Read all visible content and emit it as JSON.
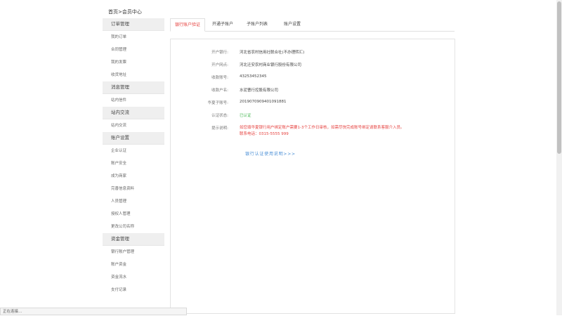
{
  "breadcrumb": "首页>会员中心",
  "sidebar": {
    "groups": [
      {
        "title": "订单管理",
        "items": [
          "我的订单",
          "合同管理",
          "我的发票",
          "收货地址"
        ]
      },
      {
        "title": "消息管理",
        "items": [
          "站内信件"
        ]
      },
      {
        "title": "站内交流",
        "items": [
          "站内交流"
        ]
      },
      {
        "title": "账户设置",
        "items": [
          "企业认证",
          "账户安全",
          "成为商家",
          "完善信息资料",
          "人员管理",
          "授权人管理",
          "更改公司名称"
        ]
      },
      {
        "title": "资金管理",
        "items": [
          "银行账户管理",
          "账户资金",
          "资金流水",
          "支付记录"
        ]
      }
    ]
  },
  "tabs": [
    "银行账户验证",
    "开通子账户",
    "子账户列表",
    "账户设置"
  ],
  "form": {
    "bank_label": "开户银行:",
    "bank_value": "河北省农村信用社联合社(不办理转汇)",
    "branch_label": "开户网点:",
    "branch_value": "河北迁安农村商业银行股份有限公司",
    "account_no_label": "收款账号:",
    "account_no_value": "43253452345",
    "account_name_label": "收款户名:",
    "account_name_value": "水泥曹行控股有限公司",
    "sub_account_label": "华夏子账号:",
    "sub_account_value": "2019070909401091881",
    "status_label": "认证状态:",
    "status_value": "已认证",
    "tip_label": "提示说明:",
    "tip_line1": "如您填华夏银行用户绑定账户需要1-3个工作日审核，如需尽快完成账号绑定请联系客服介入员。",
    "tip_line2": "联系电话：0315-5555 999"
  },
  "guide_link": "银行认证使用说明>>>",
  "status_bar": "正在连接...",
  "colors": {
    "accent_red": "#e64340",
    "success_green": "#3db34a",
    "link_blue": "#4a8fd6"
  }
}
